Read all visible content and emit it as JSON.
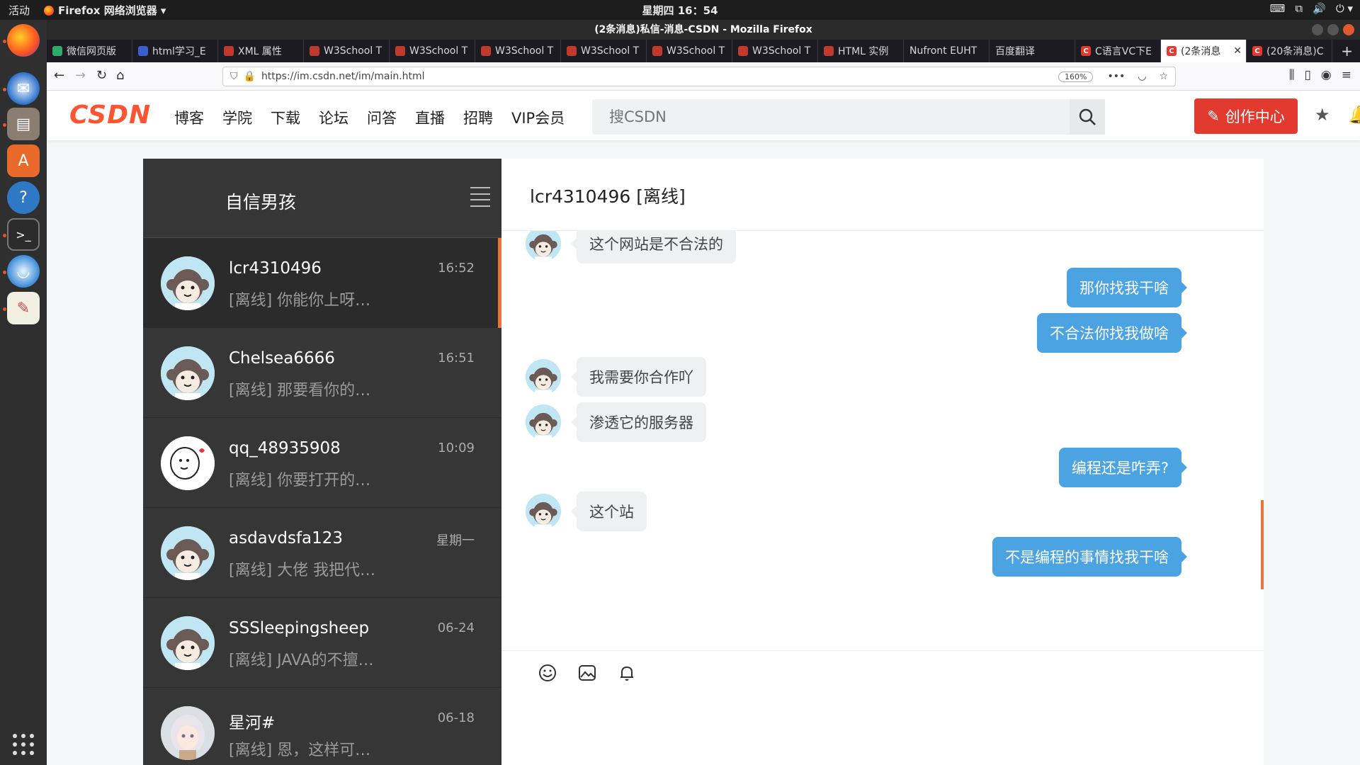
{
  "system": {
    "activities": "活动",
    "app_menu": "Firefox 网络浏览器 ▾",
    "clock": "星期四 16：54"
  },
  "window": {
    "title": "(2条消息)私信-消息-CSDN - Mozilla Firefox"
  },
  "tabs": [
    {
      "label": "微信网页版",
      "color": "#2aae67"
    },
    {
      "label": "html学习_E",
      "color": "#3b5fd0"
    },
    {
      "label": "XML 属性",
      "color": "#c0392b"
    },
    {
      "label": "W3School T",
      "color": "#c0392b"
    },
    {
      "label": "W3School T",
      "color": "#c0392b"
    },
    {
      "label": "W3School T",
      "color": "#c0392b"
    },
    {
      "label": "W3School T",
      "color": "#c0392b"
    },
    {
      "label": "W3School T",
      "color": "#c0392b"
    },
    {
      "label": "W3School T",
      "color": "#c0392b"
    },
    {
      "label": "HTML 实例",
      "color": "#c0392b"
    },
    {
      "label": "Nufront EUHT",
      "color": ""
    },
    {
      "label": "百度翻译",
      "color": ""
    },
    {
      "label": "C语言VC下E",
      "color": "#e33a2f"
    },
    {
      "label": "(2条消息",
      "color": "#e33a2f"
    },
    {
      "label": "(20条消息)C",
      "color": "#e33a2f"
    }
  ],
  "browser": {
    "url": "https://im.csdn.net/im/main.html",
    "zoom": "160%"
  },
  "csdn": {
    "logo": "CSDN",
    "nav": [
      "博客",
      "学院",
      "下载",
      "论坛",
      "问答",
      "直播",
      "招聘",
      "VIP会员"
    ],
    "search_placeholder": "搜CSDN",
    "create_label": "创作中心"
  },
  "sidebar": {
    "username": "自信男孩",
    "conversations": [
      {
        "name": "lcr4310496",
        "time": "16:52",
        "preview": "[离线] 你能你上呀…",
        "avatar": "monkey"
      },
      {
        "name": "Chelsea6666",
        "time": "16:51",
        "preview": "[离线] 那要看你的…",
        "avatar": "monkey"
      },
      {
        "name": "qq_48935908",
        "time": "10:09",
        "preview": "[离线] 你要打开的…",
        "avatar": "cartoon"
      },
      {
        "name": "asdavdsfa123",
        "time": "星期一",
        "preview": "[离线] 大佬 我把代…",
        "avatar": "monkey"
      },
      {
        "name": "SSSleepingsheep",
        "time": "06-24",
        "preview": "[离线] JAVA的不擅…",
        "avatar": "monkey"
      },
      {
        "name": "星河#",
        "time": "06-18",
        "preview": "[离线] 恩，这样可…",
        "avatar": "girl"
      }
    ]
  },
  "chat": {
    "header": "lcr4310496 [离线]",
    "messages": [
      {
        "side": "left",
        "text": "这个网站是不合法的"
      },
      {
        "side": "right",
        "text": "那你找我干啥"
      },
      {
        "side": "right",
        "text": "不合法你找我做啥"
      },
      {
        "side": "left",
        "text": "我需要你合作吖"
      },
      {
        "side": "left",
        "text": "渗透它的服务器"
      },
      {
        "side": "right",
        "text": "编程还是咋弄?"
      },
      {
        "side": "left",
        "text": "这个站"
      },
      {
        "side": "right",
        "text": "不是编程的事情找我干啥"
      }
    ]
  }
}
